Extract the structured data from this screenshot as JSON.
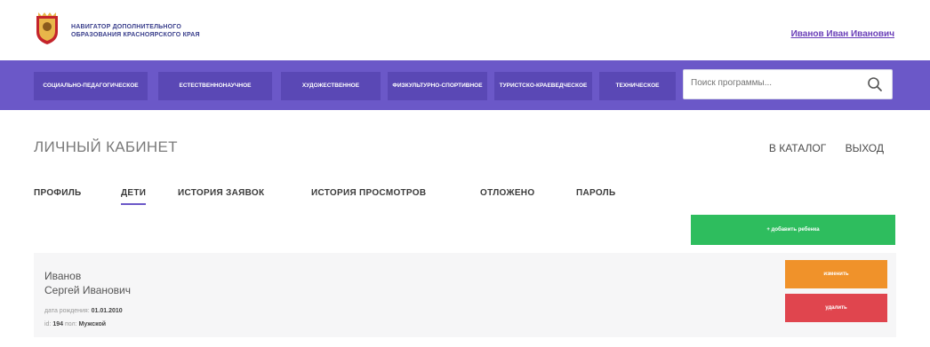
{
  "header": {
    "brand_line1": "Навигатор дополнительного",
    "brand_line2": "образования Красноярского края",
    "user_name": "Иванов Иван Иванович"
  },
  "nav": {
    "items": [
      {
        "label": "Социально-педагогическое"
      },
      {
        "label": "Естественнонаучное"
      },
      {
        "label": "Художественное"
      },
      {
        "label": "Физкультурно-спортивное"
      },
      {
        "label": "Туристско-краеведческое"
      },
      {
        "label": "Техническое"
      }
    ],
    "search_placeholder": "Поиск программы..."
  },
  "cabinet": {
    "title": "ЛИЧНЫЙ КАБИНЕТ",
    "catalog_link": "В КАТАЛОГ",
    "logout_link": "ВЫХОД",
    "tabs": [
      {
        "label": "ПРОФИЛЬ"
      },
      {
        "label": "ДЕТИ"
      },
      {
        "label": "ИСТОРИЯ ЗАЯВОК"
      },
      {
        "label": "ИСТОРИЯ ПРОСМОТРОВ"
      },
      {
        "label": "ОТЛОЖЕНО"
      },
      {
        "label": "ПАРОЛЬ"
      }
    ],
    "add_child_label": "+ добавить ребенка"
  },
  "child": {
    "last_name": "Иванов",
    "first_middle": "Сергей Иванович",
    "birth_label": "дата рождения:",
    "birth_date": "01.01.2010",
    "id_label": "id:",
    "id_value": "194",
    "gender_label": "пол:",
    "gender_value": "Мужской",
    "edit_label": "изменить",
    "delete_label": "удалить"
  },
  "colors": {
    "nav_bg": "#6b58c8",
    "add_button": "#2ebd5e",
    "edit_button": "#f0922a",
    "delete_button": "#e0454e"
  },
  "icons": {
    "logo": "coat-of-arms",
    "search": "search-icon"
  }
}
